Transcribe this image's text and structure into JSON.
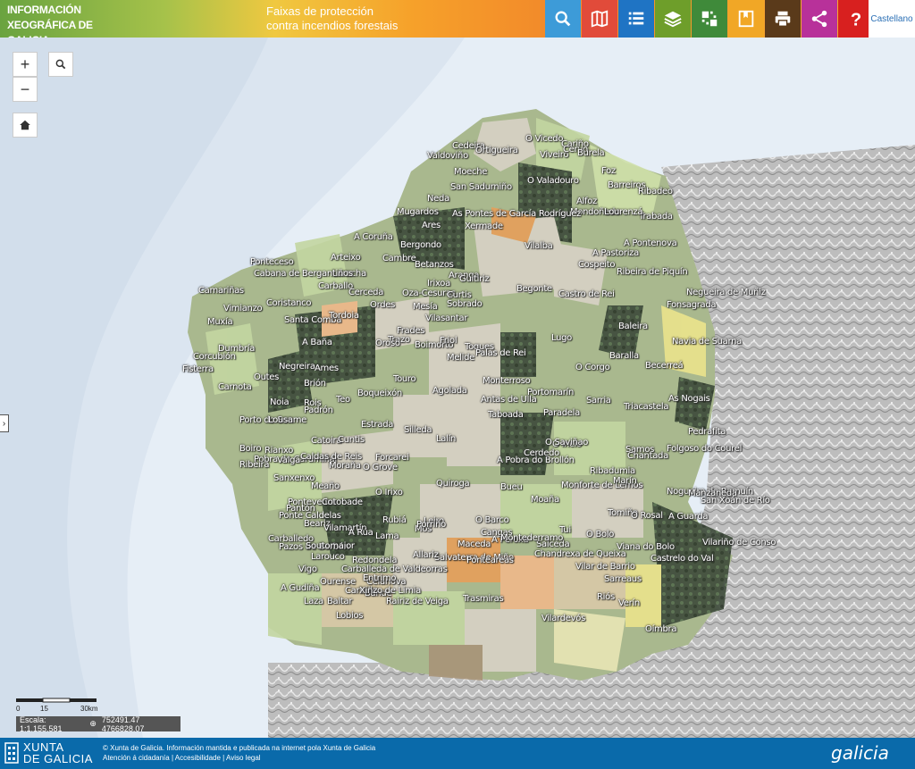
{
  "header": {
    "brand_line1": "INFORMACIÓN",
    "brand_line2": "XEOGRÁFICA DE GALICIA",
    "layer_title_line1": "Faixas de protección",
    "layer_title_line2": "contra incendios forestais",
    "language": "Castellano",
    "tools": [
      {
        "icon": "search-icon",
        "color": "#3d9bd8"
      },
      {
        "icon": "book-map-icon",
        "color": "#e14b3a"
      },
      {
        "icon": "list-icon",
        "color": "#1f74c4"
      },
      {
        "icon": "layers-icon",
        "color": "#6e9e2a"
      },
      {
        "icon": "grid-icon",
        "color": "#3f8a3a"
      },
      {
        "icon": "bookmark-icon",
        "color": "#f1a726"
      },
      {
        "icon": "print-icon",
        "color": "#5a3a1a"
      },
      {
        "icon": "share-icon",
        "color": "#b8319a"
      },
      {
        "icon": "help-icon",
        "color": "#d8201f"
      }
    ]
  },
  "map": {
    "controls": {
      "zoom_in": "+",
      "zoom_out": "−"
    },
    "places": [
      "O Vicedo",
      "Cedeira",
      "Ortigueira",
      "Cariño",
      "Valdoviño",
      "Viveiro",
      "Cervo",
      "Burela",
      "Moeche",
      "Foz",
      "San Sadurniño",
      "O Valadouro",
      "Barreiros",
      "Ribadeo",
      "Alfoz",
      "Trabada",
      "Mondoñedo",
      "Lourenzá",
      "Neda",
      "Mugardos",
      "As Pontes de García Rodríguez",
      "Xermade",
      "Ares",
      "A Pastoriza",
      "A Pontenova",
      "A Coruña",
      "Arteixo",
      "Cambre",
      "Bergondo",
      "Betanzos",
      "Vilalba",
      "Ribeira de Piquín",
      "Laracha",
      "Aranga",
      "Irixoa",
      "Guitiriz",
      "Cospeito",
      "Ponteceso",
      "Cabana de Bergantiños",
      "Carballo",
      "Cerceda",
      "Oza-Cesuras",
      "Curtis",
      "Begonte",
      "Castro de Rei",
      "Negueira de Muñiz",
      "Camariñas",
      "Coristanco",
      "Ordes",
      "Mesía",
      "Sobrado",
      "Fonsagrada",
      "Vimianzo",
      "Santa Comba",
      "Tordoia",
      "Frades",
      "Vilasantar",
      "Lugo",
      "Baleira",
      "Muxía",
      "Trazo",
      "Oroso",
      "Boimorto",
      "Toques",
      "Friol",
      "Navia de Suarna",
      "Dumbría",
      "A Baña",
      "Negreira",
      "Ames",
      "Palas de Rei",
      "Melide",
      "Baralla",
      "Corcubión",
      "Fisterra",
      "Outes",
      "Brión",
      "Touro",
      "Monterroso",
      "O Corgo",
      "Becerreá",
      "Carnota",
      "Noia",
      "Rois",
      "Teo",
      "Boqueixón",
      "Agolada",
      "Antas de Ulla",
      "Portomarín",
      "Paradela",
      "Sarria",
      "Triacastela",
      "As Nogais",
      "Porto do Son",
      "Lousame",
      "Padrón",
      "Estrada",
      "Silleda",
      "Lalín",
      "Taboada",
      "O Incio",
      "Samos",
      "Pedrafita",
      "Boiro",
      "Rianxo",
      "Catoira",
      "Cuntis",
      "Pobra do Caramiñal",
      "Valga",
      "O Saviñao",
      "Folgoso do Courel",
      "Ribeira",
      "Caldas de Reis",
      "Moraña",
      "Forcarei",
      "A Pobra do Brollón",
      "Chantada",
      "Monforte de Lemos",
      "Cerdedo",
      "Ribadumia",
      "O Grove",
      "Meaño",
      "Sanxenxo",
      "Pontevedra",
      "Cotobade",
      "O Irixo",
      "Pantón",
      "Quiroga",
      "Bueu",
      "Marín",
      "Ponte Caldelas",
      "Beariz",
      "Carballedo",
      "Vilamartín",
      "A Rúa",
      "Rubiá",
      "O Barco",
      "Cangas",
      "Moaña",
      "Pazos de Borbén",
      "Soutomaior",
      "Redondela",
      "Lama",
      "Leiro",
      "A Peroxa",
      "Nogueira de Ramuín",
      "Manzaneda",
      "San Xoán de Río",
      "Larouco",
      "Carballeda de Valdeorras",
      "Vigo",
      "Mos",
      "Porriño",
      "Salvaterra de Miño",
      "Ponteareas",
      "Salceda",
      "Tui",
      "Tomiño",
      "O Rosal",
      "A Guarda",
      "Ourense",
      "Cartelle",
      "Celanova",
      "Allariz",
      "Maceda",
      "Montederramo",
      "Chandrexa de Queixa",
      "O Bolo",
      "Viana do Bolo",
      "Vilariño de Conso",
      "A Gudiña",
      "Laza",
      "Baltar",
      "Lobios",
      "Entrimo",
      "Bande",
      "Xinzo de Limia",
      "Rairiz de Veiga",
      "Trasmiras",
      "Vilar de Barrio",
      "Sarreaus",
      "Castrelo do Val",
      "Riós",
      "Verín",
      "Oímbra",
      "Vilardevós"
    ]
  },
  "scale": {
    "label": "Escala: 1:1.155.581",
    "coords": "752491.47  4766828.07",
    "ticks": [
      "0",
      "15",
      "30km"
    ]
  },
  "footer": {
    "xunta_line1": "XUNTA",
    "xunta_line2": "DE GALICIA",
    "copyright": "© Xunta de Galicia. Información mantida e publicada na internet pola Xunta de Galicia",
    "links": "Atención á cidadanía | Accesibilidade | Aviso legal",
    "galicia_logo": "galicia"
  }
}
